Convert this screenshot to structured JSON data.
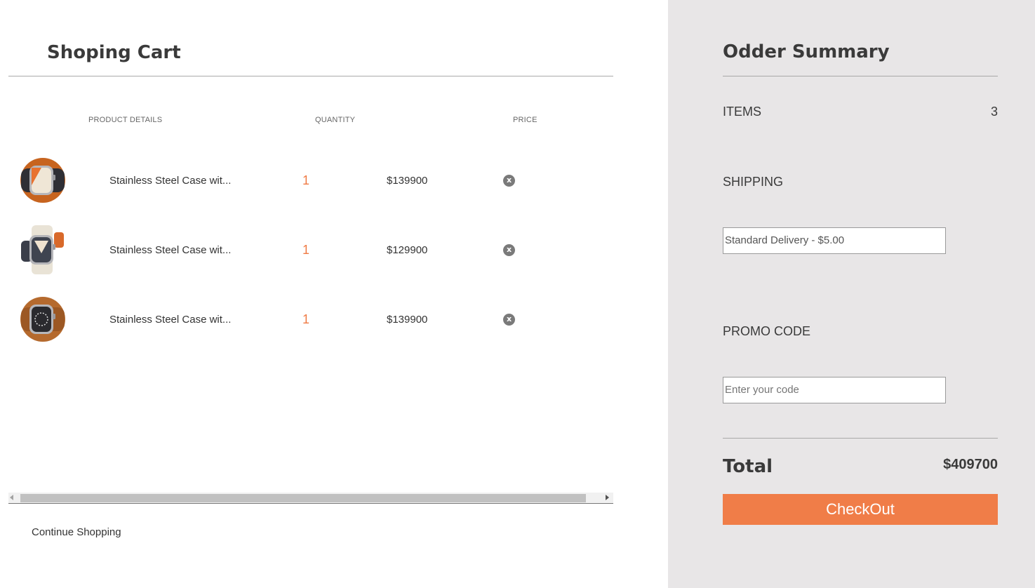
{
  "cart": {
    "title": "Shoping Cart",
    "headers": {
      "product": "PRODUCT DETAILS",
      "quantity": "QUANTITY",
      "price": "PRICE"
    },
    "items": [
      {
        "name": "Stainless Steel Case wit...",
        "quantity": "1",
        "price": "$139900",
        "remove": "x",
        "image_icon": "watch-orange-double-tour"
      },
      {
        "name": "Stainless Steel Case wit...",
        "quantity": "1",
        "price": "$129900",
        "remove": "x",
        "image_icon": "watch-white-single-tour"
      },
      {
        "name": "Stainless Steel Case wit...",
        "quantity": "1",
        "price": "$139900",
        "remove": "x",
        "image_icon": "watch-brown-double-tour"
      }
    ],
    "continue_label": "Continue Shopping"
  },
  "summary": {
    "title": "Odder Summary",
    "items_label": "ITEMS",
    "items_count": "3",
    "shipping_label": "SHIPPING",
    "shipping_value": "Standard Delivery - $5.00",
    "promo_label": "PROMO CODE",
    "promo_placeholder": "Enter your code",
    "total_label": "Total",
    "total_value": "$409700",
    "checkout_label": "CheckOut"
  },
  "colors": {
    "accent": "#f07d48",
    "summary_bg": "#e8e6e7",
    "remove_icon": "#7a7a7a"
  }
}
